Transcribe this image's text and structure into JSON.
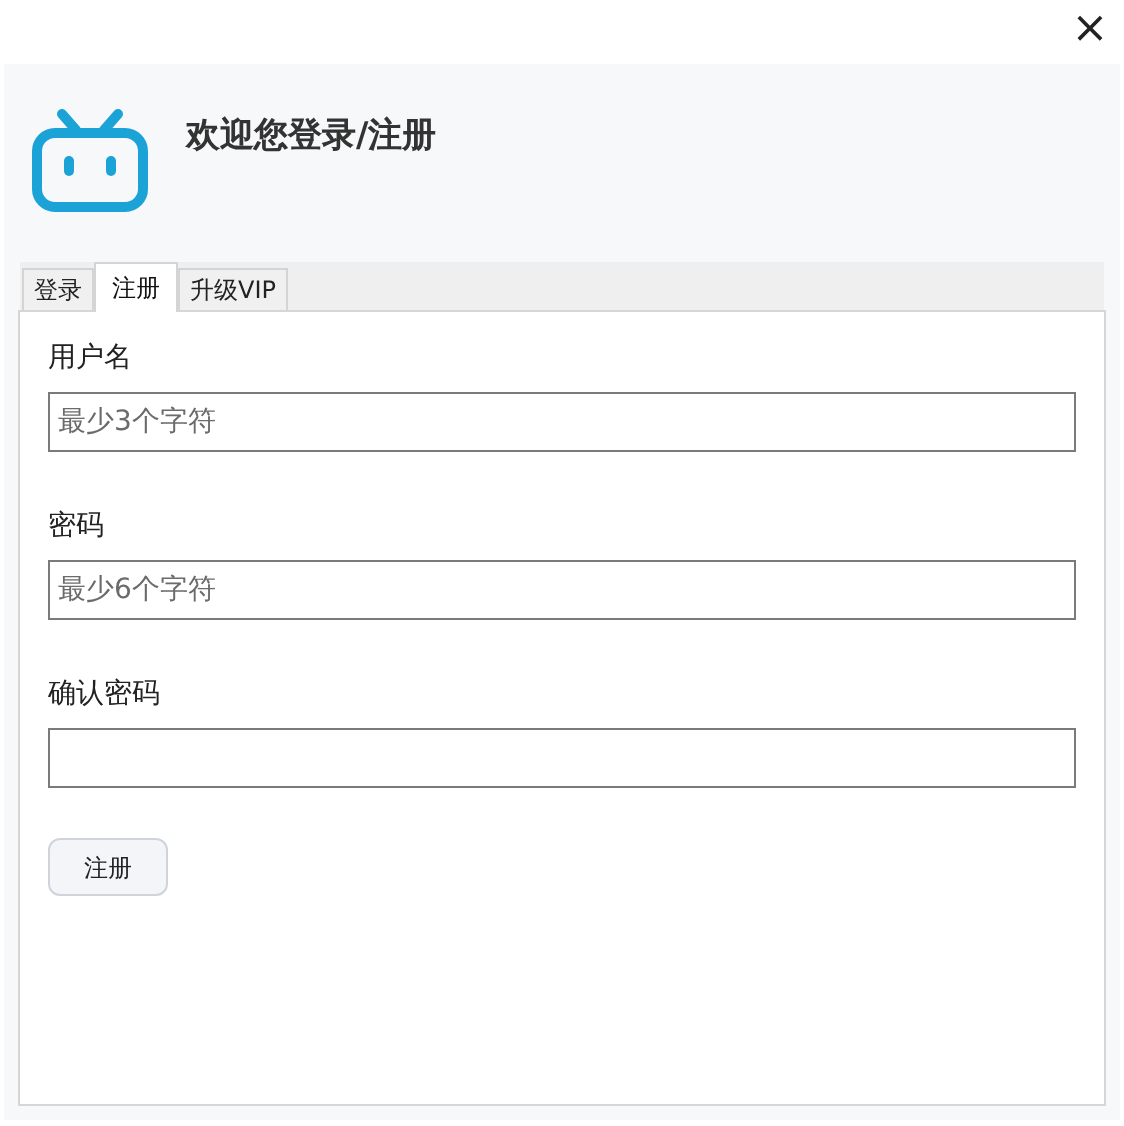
{
  "window": {
    "close": "×"
  },
  "header": {
    "title": "欢迎您登录/注册"
  },
  "tabs": [
    {
      "label": "登录",
      "selected": false
    },
    {
      "label": "注册",
      "selected": true
    },
    {
      "label": "升级VIP",
      "selected": false
    }
  ],
  "form": {
    "fields": [
      {
        "label": "用户名",
        "placeholder": "最少3个字符"
      },
      {
        "label": "密码",
        "placeholder": "最少6个字符"
      },
      {
        "label": "确认密码"
      }
    ],
    "submit": "注册"
  }
}
